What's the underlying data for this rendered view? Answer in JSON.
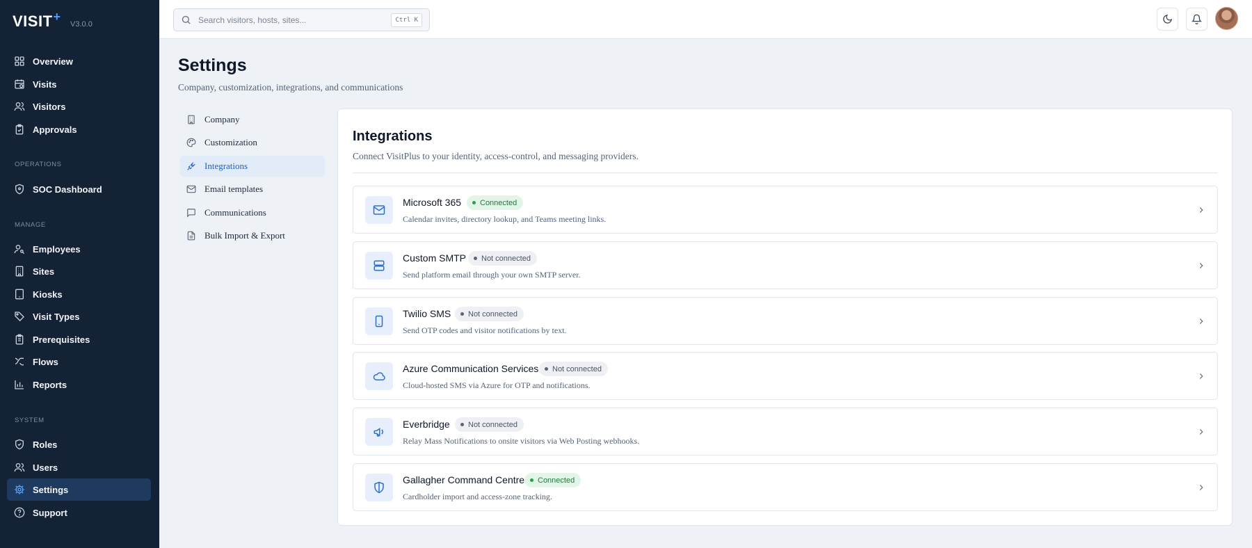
{
  "brand": {
    "name": "VISIT",
    "plus": "+",
    "version": "V3.0.0"
  },
  "sidebar": {
    "items": [
      {
        "label": "Overview",
        "icon": "grid-icon"
      },
      {
        "label": "Visits",
        "icon": "calendar-clock-icon"
      },
      {
        "label": "Visitors",
        "icon": "users-icon"
      },
      {
        "label": "Approvals",
        "icon": "clipboard-check-icon"
      }
    ],
    "operations_title": "OPERATIONS",
    "operations": [
      {
        "label": "SOC Dashboard",
        "icon": "shield-icon"
      }
    ],
    "manage_title": "MANAGE",
    "manage": [
      {
        "label": "Employees",
        "icon": "user-key-icon"
      },
      {
        "label": "Sites",
        "icon": "building-icon"
      },
      {
        "label": "Kiosks",
        "icon": "tablet-icon"
      },
      {
        "label": "Visit Types",
        "icon": "tags-icon"
      },
      {
        "label": "Prerequisites",
        "icon": "clipboard-list-icon"
      },
      {
        "label": "Flows",
        "icon": "workflow-icon"
      },
      {
        "label": "Reports",
        "icon": "bar-chart-icon"
      }
    ],
    "system_title": "SYSTEM",
    "system": [
      {
        "label": "Roles",
        "icon": "shield-check-icon"
      },
      {
        "label": "Users",
        "icon": "users-icon"
      },
      {
        "label": "Settings",
        "icon": "gear-icon",
        "active": true
      },
      {
        "label": "Support",
        "icon": "help-circle-icon"
      }
    ]
  },
  "topbar": {
    "search_placeholder": "Search visitors, hosts, sites...",
    "search_shortcut": "Ctrl K"
  },
  "page": {
    "title": "Settings",
    "subtitle": "Company, customization, integrations, and communications"
  },
  "settings_nav": [
    {
      "label": "Company",
      "icon": "building-icon"
    },
    {
      "label": "Customization",
      "icon": "palette-icon"
    },
    {
      "label": "Integrations",
      "icon": "plug-icon",
      "active": true
    },
    {
      "label": "Email templates",
      "icon": "mail-icon"
    },
    {
      "label": "Communications",
      "icon": "message-square-icon"
    },
    {
      "label": "Bulk Import & Export",
      "icon": "file-icon"
    }
  ],
  "integrations": {
    "title": "Integrations",
    "subtitle": "Connect VisitPlus to your identity, access-control, and messaging providers.",
    "items": [
      {
        "name": "Microsoft 365",
        "status": "Connected",
        "connected": true,
        "description": "Calendar invites, directory lookup, and Teams meeting links.",
        "icon": "mail-icon"
      },
      {
        "name": "Custom SMTP",
        "status": "Not connected",
        "connected": false,
        "description": "Send platform email through your own SMTP server.",
        "icon": "server-icon"
      },
      {
        "name": "Twilio SMS",
        "status": "Not connected",
        "connected": false,
        "description": "Send OTP codes and visitor notifications by text.",
        "icon": "smartphone-icon"
      },
      {
        "name": "Azure Communication Services",
        "status": "Not connected",
        "connected": false,
        "description": "Cloud-hosted SMS via Azure for OTP and notifications.",
        "icon": "cloud-icon"
      },
      {
        "name": "Everbridge",
        "status": "Not connected",
        "connected": false,
        "description": "Relay Mass Notifications to onsite visitors via Web Posting webhooks.",
        "icon": "megaphone-icon"
      },
      {
        "name": "Gallagher Command Centre",
        "status": "Connected",
        "connected": true,
        "description": "Cardholder import and access-zone tracking.",
        "icon": "shield-icon"
      }
    ]
  },
  "colors": {
    "sidebar_bg": "#142236",
    "accent": "#2563c9",
    "connected": "#26a047"
  }
}
